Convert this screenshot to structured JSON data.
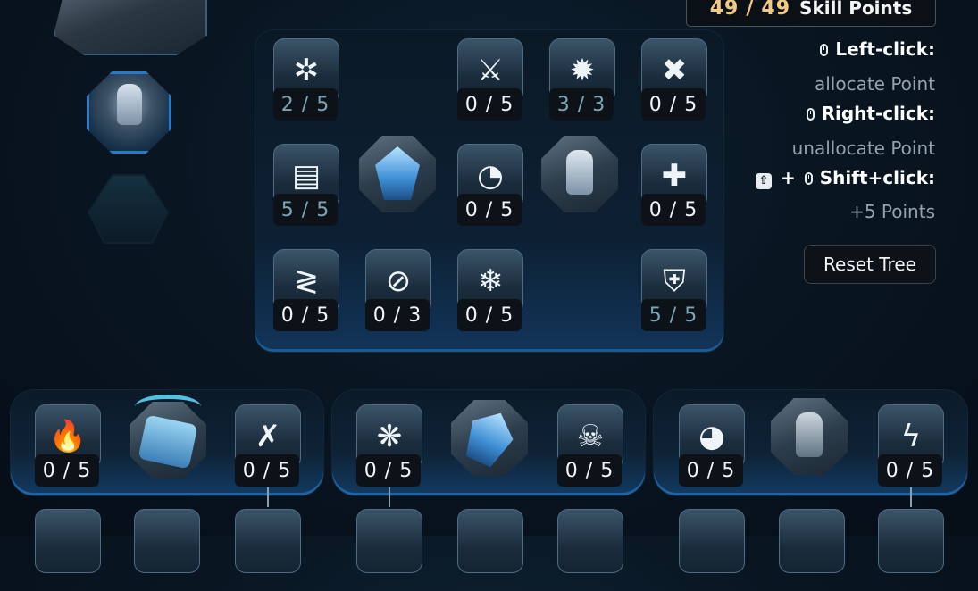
{
  "skill_points": {
    "current": "49",
    "separator": "/",
    "total": "49",
    "label": "Skill Points"
  },
  "help": {
    "left_click": "Left-click:",
    "left_desc": "allocate Point",
    "right_click": "Right-click:",
    "right_desc": "unallocate Point",
    "plus": "+",
    "shift_click": "Shift+click:",
    "shift_desc": "+5 Points"
  },
  "reset_label": "Reset Tree",
  "main_tree": {
    "nodes": [
      {
        "name": "skill-gear-node",
        "count": "2 / 5",
        "state": "partial",
        "icon": "✲"
      },
      {
        "name": "skill-missile-node",
        "count": "0 / 5",
        "state": "empty",
        "icon": "⚔"
      },
      {
        "name": "skill-burst-node",
        "count": "3 / 3",
        "state": "full",
        "icon": "✹"
      },
      {
        "name": "skill-cross-node",
        "count": "0 / 5",
        "state": "empty",
        "icon": "✖"
      },
      {
        "name": "skill-barrier-node",
        "count": "5 / 5",
        "state": "full",
        "icon": "▤"
      },
      {
        "name": "skill-grenade-node",
        "count": "0 / 5",
        "state": "empty",
        "icon": "◔"
      },
      {
        "name": "skill-medic-node",
        "count": "0 / 5",
        "state": "empty",
        "icon": "✚"
      },
      {
        "name": "skill-zigzag-node",
        "count": "0 / 5",
        "state": "empty",
        "icon": "≷"
      },
      {
        "name": "skill-cancel-node",
        "count": "0 / 3",
        "state": "empty",
        "icon": "⊘"
      },
      {
        "name": "skill-frost-node",
        "count": "0 / 5",
        "state": "empty",
        "icon": "❄"
      },
      {
        "name": "skill-armor-node",
        "count": "5 / 5",
        "state": "full",
        "icon": "⛨"
      }
    ]
  },
  "bottom_trees": [
    {
      "nodes": [
        {
          "name": "fire-zigzag-node",
          "count": "0 / 5",
          "icon": "🔥"
        },
        {
          "name": "fire-cross-node",
          "count": "0 / 5",
          "icon": "✗"
        }
      ]
    },
    {
      "nodes": [
        {
          "name": "frost-cross-node",
          "count": "0 / 5",
          "icon": "❋"
        },
        {
          "name": "skull-burst-node",
          "count": "0 / 5",
          "icon": "☠"
        }
      ]
    },
    {
      "nodes": [
        {
          "name": "grenade-fire-node",
          "count": "0 / 5",
          "icon": "◕"
        },
        {
          "name": "lightning-cross-node",
          "count": "0 / 5",
          "icon": "ϟ"
        }
      ]
    }
  ]
}
